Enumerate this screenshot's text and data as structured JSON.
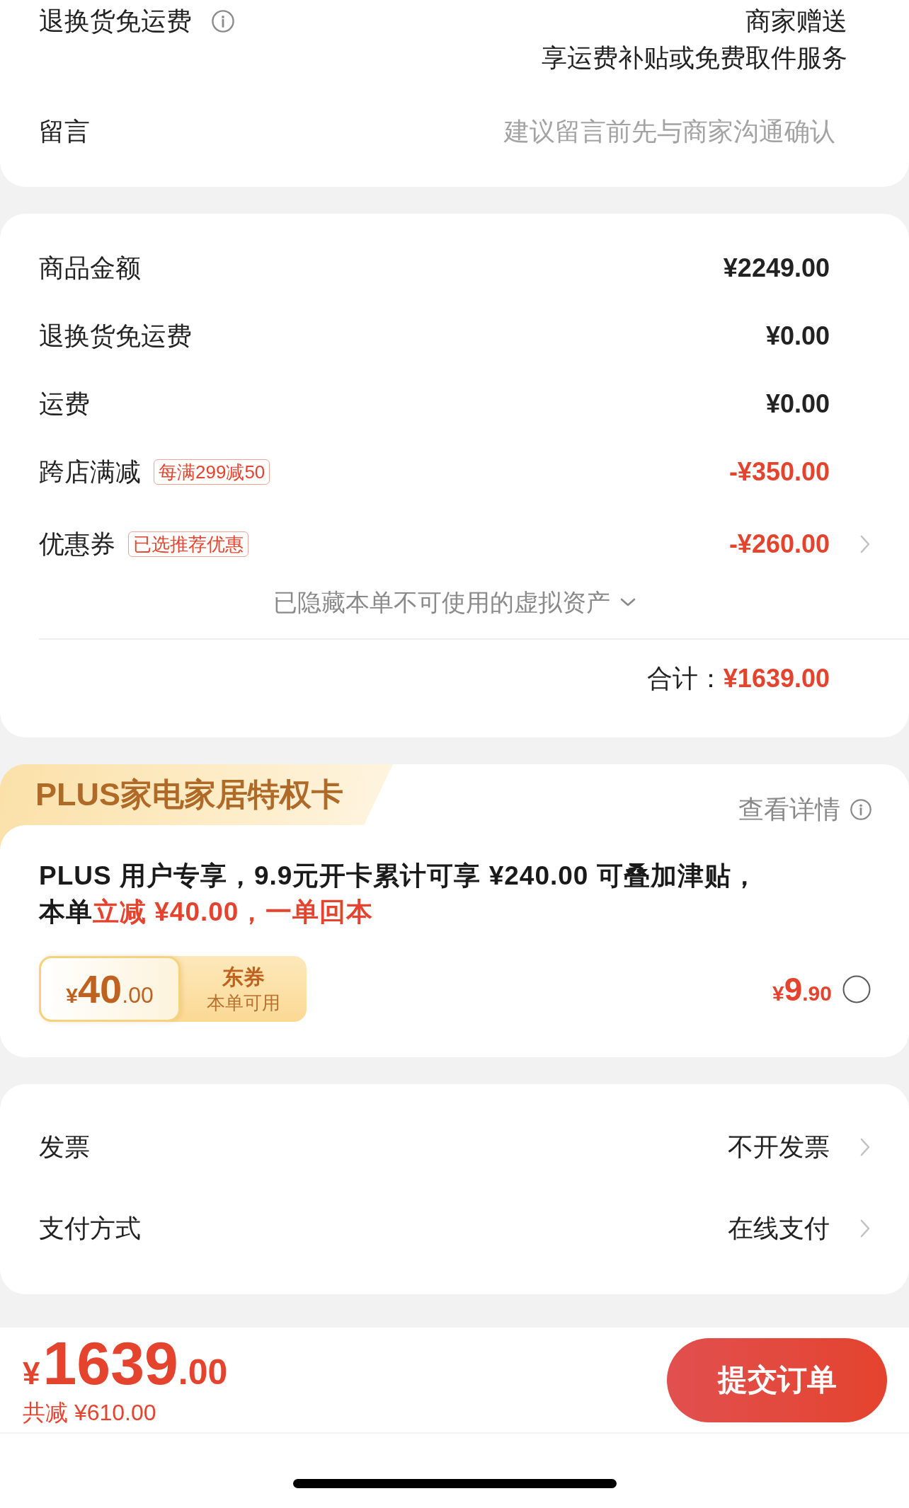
{
  "return_shipping": {
    "label": "退换货免运费",
    "value_lines": [
      "商家赠送",
      "享运费补贴或免费取件服务"
    ]
  },
  "message": {
    "label": "留言",
    "placeholder": "建议留言前先与商家沟通确认"
  },
  "price_summary": {
    "rows": [
      {
        "label": "商品金额",
        "value": "¥2249.00",
        "kind": "amount",
        "navigable": false
      },
      {
        "label": "退换货免运费",
        "value": "¥0.00",
        "kind": "amount",
        "navigable": false
      },
      {
        "label": "运费",
        "value": "¥0.00",
        "kind": "amount",
        "navigable": false
      },
      {
        "label": "跨店满减",
        "tag": "每满299减50",
        "value": "-¥350.00",
        "kind": "discount",
        "navigable": false
      },
      {
        "label": "优惠券",
        "tag": "已选推荐优惠",
        "value": "-¥260.00",
        "kind": "discount",
        "navigable": true
      }
    ],
    "hidden_assets": {
      "label": "已隐藏本单不可使用的虚拟资产",
      "expanded": false
    },
    "total": {
      "label": "合计：",
      "value": "¥1639.00"
    }
  },
  "plus_card": {
    "title": "PLUS家电家居特权卡",
    "details_link": "查看详情",
    "description_lines": [
      [
        {
          "text": "PLUS 用户专享，9.9元开卡累计可享 ¥240.00 可叠加津贴，",
          "emphasis": false
        }
      ],
      [
        {
          "text": "本单",
          "emphasis": false
        },
        {
          "text": "立减 ¥40.00，一单回本",
          "emphasis": true
        }
      ]
    ],
    "coupon": {
      "currency": "¥",
      "amount": "40",
      "decimals": ".00",
      "title": "东券",
      "subtitle": "本单可用"
    },
    "price": {
      "currency": "¥",
      "amount": "9",
      "decimals": ".90"
    },
    "selected": false
  },
  "options": {
    "rows": [
      {
        "label": "发票",
        "value": "不开发票"
      },
      {
        "label": "支付方式",
        "value": "在线支付"
      }
    ]
  },
  "checkout_bar": {
    "total": {
      "currency": "¥",
      "amount": "1639",
      "decimals": ".00"
    },
    "savings": "共减 ¥610.00",
    "submit_button": "提交订单"
  }
}
